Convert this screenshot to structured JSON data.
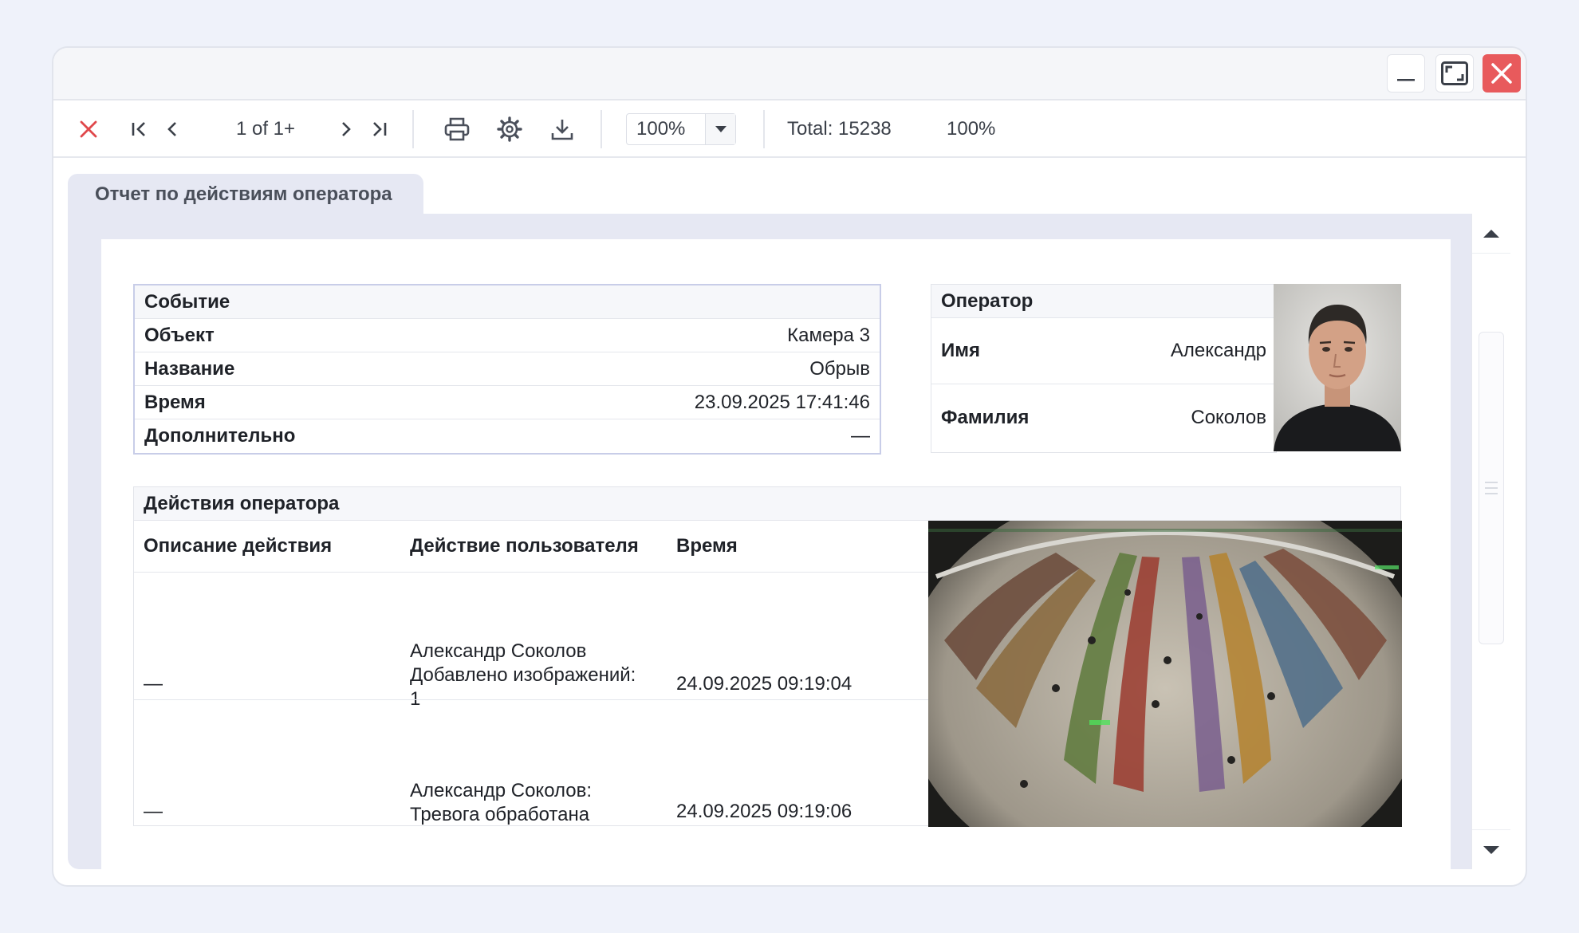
{
  "toolbar": {
    "page_indicator": "1 of 1+",
    "zoom_value": "100%",
    "total": "Total: 15238",
    "zoom_status": "100%"
  },
  "tab": {
    "title": "Отчет по действиям оператора"
  },
  "event": {
    "header": "Событие",
    "rows": [
      {
        "label": "Объект",
        "value": "Камера 3"
      },
      {
        "label": "Название",
        "value": "Обрыв"
      },
      {
        "label": "Время",
        "value": "23.09.2025 17:41:46"
      },
      {
        "label": "Дополнительно",
        "value": "—"
      }
    ]
  },
  "operator": {
    "header": "Оператор",
    "rows": [
      {
        "label": "Имя",
        "value": "Александр"
      },
      {
        "label": "Фамилия",
        "value": "Соколов"
      }
    ]
  },
  "actions": {
    "header": "Действия оператора",
    "columns": [
      "Описание действия",
      "Действие пользователя",
      "Время"
    ],
    "rows": [
      {
        "description": "—",
        "user_action_lines": [
          "Александр Соколов",
          "Добавлено изображений:",
          "1"
        ],
        "time": "24.09.2025 09:19:04"
      },
      {
        "description": "—",
        "user_action_lines": [
          "Александр Соколов:",
          "Тревога обработана"
        ],
        "time": "24.09.2025 09:19:06"
      }
    ]
  },
  "colors": {
    "close_red": "#e85a5c",
    "stage_bg": "#e6e8f3",
    "table_border": "#c8cde8"
  }
}
